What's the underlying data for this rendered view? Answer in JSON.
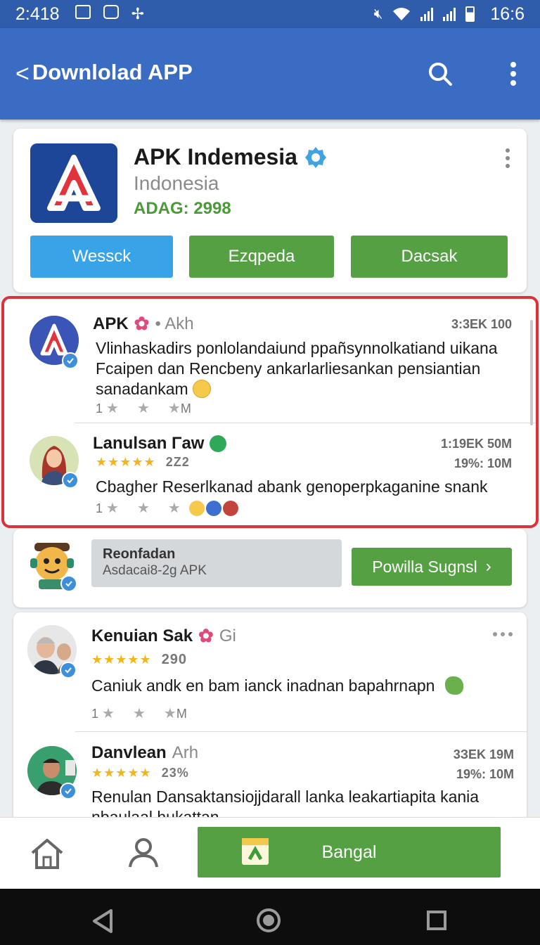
{
  "status_bar": {
    "time": "2:418",
    "clock": "16:6"
  },
  "app_bar": {
    "back_glyph": "<",
    "title": "Downlolad APP",
    "search_icon": "search-icon",
    "menu_icon": "more-vert-icon"
  },
  "app_card": {
    "name": "APK Indemesia",
    "subtitle": "Indonesia",
    "tag": "ADAG: 2998",
    "buttons": [
      "Wessck",
      "Ezqpeda",
      "Dacsak"
    ],
    "colors": {
      "blue": "#39a3e8",
      "green": "#55a043",
      "tag": "#4a9a37"
    }
  },
  "highlighted_reviews": [
    {
      "name": "APK",
      "name_suffix": "• Akh",
      "meta": [
        "3:3EK 100"
      ],
      "text": "Vlinhaskadirs ponlolandaiund ppañsynnolkatiand uikana Fcaipen dan Rencbeny ankarlarliesankan pensiantian sanadankam",
      "footer": [
        "1",
        "M"
      ]
    },
    {
      "name": "Lanulsan Γaw",
      "meta": [
        "1:19EK 50M",
        "19%: 10M"
      ],
      "rating_count": "2Z2",
      "text": "Cbagher Reserlkanad abank genoperpkaganine snank",
      "footer": [
        "1"
      ]
    }
  ],
  "recommend": {
    "title": "Reonfadan",
    "subtitle": "Asdacai8-2g APK",
    "button": "Powilla Sugnsl"
  },
  "reviews": [
    {
      "name": "Kenuian Sak",
      "name_suffix": "Gi",
      "rating_count": "290",
      "text": "Caniuk andk en bam ianck inadnan bapahrnapn",
      "footer": [
        "1",
        "M"
      ]
    },
    {
      "name": "Danvlean",
      "name_suffix": "Arh",
      "meta": [
        "3ЗEK 19M",
        "19%: 10M"
      ],
      "rating_count": "23%",
      "text": "Renulan Dansaktansiojjdarall lanka leakartiapita kania nbaulaal hukattan"
    }
  ],
  "bottom_nav": {
    "action": "Bangal"
  }
}
